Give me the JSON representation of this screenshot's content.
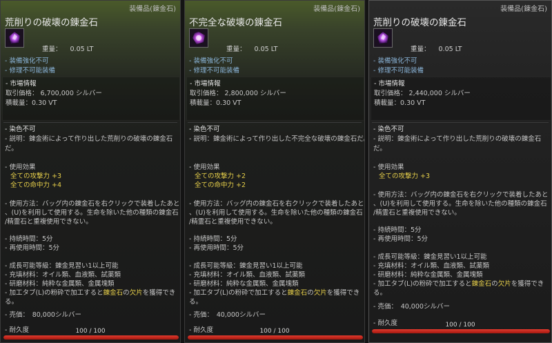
{
  "panels": [
    {
      "category": "装備品(錬金石)",
      "title": "荒削りの破壊の錬金石",
      "weight_label": "重量：",
      "weight_value": "0.05 LT",
      "status": [
        "- 装備強化不可",
        "- 修理不可能装備"
      ],
      "market": {
        "heading": "- 市場情報",
        "price": "取引価格： 6,700,000 シルバー",
        "capacity": "積載量：0.30 VT"
      },
      "dye": "- 染色不可",
      "desc": [
        "- 説明：錬金術によって作り出した荒削りの破壊の錬金石",
        "だ。"
      ],
      "effect_heading": "- 使用効果",
      "effects": [
        "全ての攻撃力 +3",
        "全ての命中力 +4"
      ],
      "usage": [
        "- 使用方法：バッグ内の錬金石を右クリックで装着したあと",
        "、(U)を利用して使用する。生命を除いた他の種類の錬金石",
        "/精霊石と重複使用できない。"
      ],
      "duration": "- 持続時間：5分",
      "cooldown": "- 再使用時間：5分",
      "growth": [
        "- 成長可能等級：錬金見習い1以上可能",
        "- 充填材料：オイル類、血液類、試薬類",
        "- 研磨材料：純粋な金属類、金属塊類"
      ],
      "process": {
        "pre": "- 加工タブ(L)の粉砕で加工すると",
        "mid": "錬金石",
        "mid2": "の",
        "post": "欠片",
        "tail": "を獲得でき",
        "line2": "る。"
      },
      "sell": "- 売価：　80,000シルバー",
      "durability_label": "- 耐久度",
      "durability_text": "100 / 100",
      "durability": 1.0
    },
    {
      "category": "装備品(錬金石)",
      "title": "不完全な破壊の錬金石",
      "weight_label": "重量：",
      "weight_value": "0.05 LT",
      "status": [
        "- 装備強化不可",
        "- 修理不可能装備"
      ],
      "market": {
        "heading": "- 市場情報",
        "price": "取引価格： 2,800,000 シルバー",
        "capacity": "積載量：0.30 VT"
      },
      "dye": "- 染色不可",
      "desc": [
        "- 説明：錬金術によって作り出した不完全な破壊の錬金石だ。"
      ],
      "effect_heading": "- 使用効果",
      "effects": [
        "全ての攻撃力 +2",
        "全ての命中力 +2"
      ],
      "usage": [
        "- 使用方法：バッグ内の錬金石を右クリックで装着したあと",
        "、(U)を利用して使用する。生命を除いた他の種類の錬金石",
        "/精霊石と重複使用できない。"
      ],
      "duration": "- 持続時間：5分",
      "cooldown": "- 再使用時間：5分",
      "growth": [
        "- 成長可能等級：錬金見習い1以上可能",
        "- 充填材料：オイル類、血液類、試薬類",
        "- 研磨材料：純粋な金属類、金属塊類"
      ],
      "process": {
        "pre": "- 加工タブ(L)の粉砕で加工すると",
        "mid": "錬金石",
        "mid2": "の",
        "post": "欠片",
        "tail": "を獲得でき",
        "line2": "る。"
      },
      "sell": "- 売価：　40,000シルバー",
      "durability_label": "- 耐久度",
      "durability_text": "100 / 100",
      "durability": 1.0
    },
    {
      "category": "装備品(錬金石)",
      "title": "荒削りの破壊の錬金石",
      "weight_label": "重量：",
      "weight_value": "0.05 LT",
      "status": [
        "- 装備強化不可",
        "- 修理不可能装備"
      ],
      "market": {
        "heading": "- 市場情報",
        "price": "取引価格： 2,440,000 シルバー",
        "capacity": "積載量：0.30 VT"
      },
      "dye": "- 染色不可",
      "desc": [
        "- 説明：錬金術によって作り出した荒削りの破壊の錬金石",
        "だ。"
      ],
      "effect_heading": "- 使用効果",
      "effects": [
        "全ての攻撃力 +3"
      ],
      "usage": [
        "- 使用方法：バッグ内の錬金石を右クリックで装着したあと",
        "、(U)を利用して使用する。生命を除いた他の種類の錬金石",
        "/精霊石と重複使用できない。"
      ],
      "duration": "- 持続時間：5分",
      "cooldown": "- 再使用時間：5分",
      "growth": [
        "- 成長可能等級：錬金見習い1以上可能",
        "- 充填材料：オイル類、血液類、試薬類",
        "- 研磨材料：純粋な金属類、金属塊類"
      ],
      "process": {
        "pre": "- 加工タブ(L)の粉砕で加工すると",
        "mid": "錬金石",
        "mid2": "の",
        "post": "欠片",
        "tail": "を獲得でき",
        "line2": "る。"
      },
      "sell": "- 売価：　40,000シルバー",
      "durability_label": "- 耐久度",
      "durability_text": "100 / 100",
      "durability": 1.0
    }
  ],
  "colors": {
    "accent_yellow": "#e6cf4a",
    "status_blue": "#8ab4d8",
    "durability_red": "#d02a20"
  },
  "icons": [
    "alchemy-stone-icon"
  ]
}
